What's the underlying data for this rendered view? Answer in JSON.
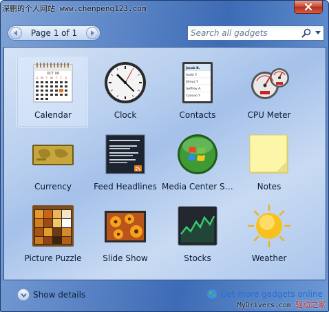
{
  "title_bar": {
    "watermark": "深鹏的个人网站 www.chenpeng123.com"
  },
  "toolbar": {
    "page_indicator": "Page 1 of 1",
    "search_placeholder": "Search all gadgets"
  },
  "gadgets": [
    {
      "name": "Calendar",
      "icon": "calendar-icon",
      "selected": true
    },
    {
      "name": "Clock",
      "icon": "clock-icon"
    },
    {
      "name": "Contacts",
      "icon": "contacts-icon"
    },
    {
      "name": "CPU Meter",
      "icon": "cpu-meter-icon"
    },
    {
      "name": "Currency",
      "icon": "currency-icon"
    },
    {
      "name": "Feed Headlines",
      "icon": "feed-headlines-icon"
    },
    {
      "name": "Media Center Si...",
      "icon": "media-center-icon"
    },
    {
      "name": "Notes",
      "icon": "notes-icon"
    },
    {
      "name": "Picture Puzzle",
      "icon": "picture-puzzle-icon"
    },
    {
      "name": "Slide Show",
      "icon": "slide-show-icon"
    },
    {
      "name": "Stocks",
      "icon": "stocks-icon"
    },
    {
      "name": "Weather",
      "icon": "weather-icon"
    }
  ],
  "calendar_icon": {
    "month": "OCT 06",
    "weekdays": [
      "S",
      "M",
      "T",
      "W",
      "T",
      "F",
      "S"
    ]
  },
  "contacts_icon": {
    "entries": [
      "Jacob B.",
      "Andri Y.",
      "Simus Y.",
      "Geffrey A.",
      "Cyouvo Y."
    ]
  },
  "bottom_bar": {
    "show_details": "Show details",
    "get_more": "Get more gadgets online",
    "watermark": "MyDrivers.com",
    "watermark_cn": "驱动之家"
  },
  "colors": {
    "frame": "#4f7cc0",
    "link": "#2a6fd6",
    "close_button": "#c8412a"
  }
}
